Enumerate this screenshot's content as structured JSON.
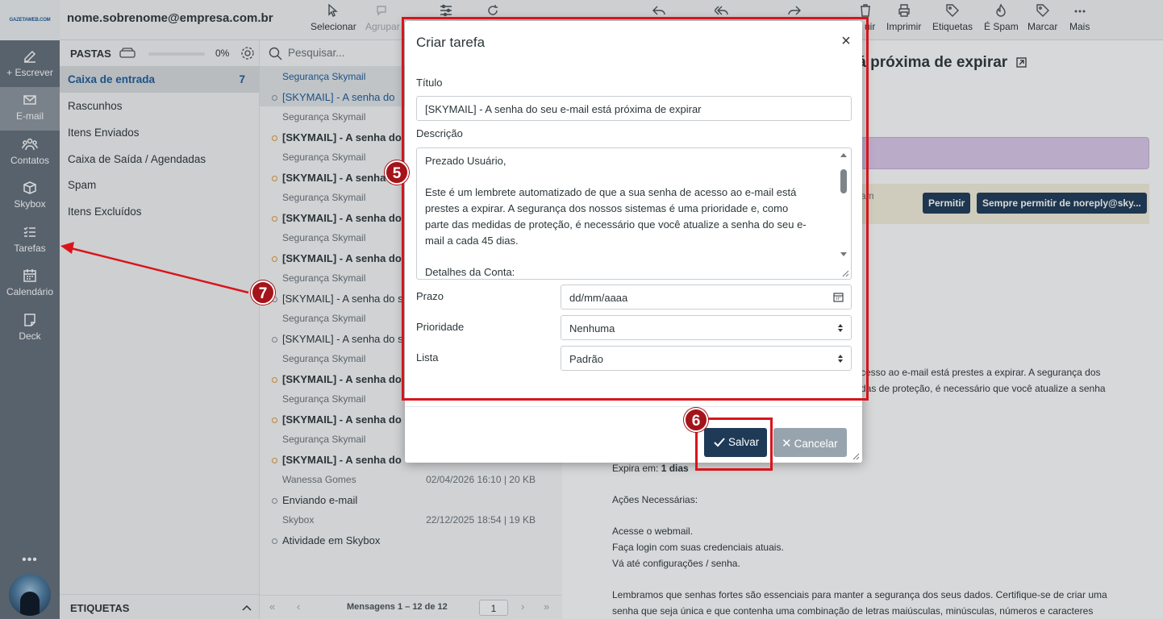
{
  "logo_text": "GAZETAWEB.COM",
  "user_email": "nome.sobrenome@empresa.com.br",
  "nav": {
    "compose": "+ Escrever",
    "email": "E-mail",
    "contacts": "Contatos",
    "skybox": "Skybox",
    "tasks": "Tarefas",
    "calendar": "Calendário",
    "deck": "Deck",
    "more": "•••"
  },
  "toolbar": {
    "select": "Selecionar",
    "group": "Agrupar",
    "delete_partial": "uir",
    "print": "Imprimir",
    "tags": "Etiquetas",
    "spam": "É Spam",
    "mark": "Marcar",
    "more": "Mais"
  },
  "folders": {
    "title": "PASTAS",
    "quota": "0%",
    "items": [
      {
        "label": "Caixa de entrada",
        "count": "7"
      },
      {
        "label": "Rascunhos"
      },
      {
        "label": "Itens Enviados"
      },
      {
        "label": "Caixa de Saída / Agendadas"
      },
      {
        "label": "Spam"
      },
      {
        "label": "Itens Excluídos"
      }
    ],
    "tags_title": "ETIQUETAS"
  },
  "search": {
    "placeholder": "Pesquisar..."
  },
  "messages": [
    {
      "from": "Segurança Skymail",
      "subject": "[SKYMAIL] - A senha do"
    },
    {
      "from": "Segurança Skymail",
      "subject": "[SKYMAIL] - A senha do"
    },
    {
      "from": "Segurança Skymail",
      "subject": "[SKYMAIL] - A senha"
    },
    {
      "from": "Segurança Skymail",
      "subject": "[SKYMAIL] - A senha do"
    },
    {
      "from": "Segurança Skymail",
      "subject": "[SKYMAIL] - A senha do"
    },
    {
      "from": "Segurança Skymail",
      "subject": "[SKYMAIL] - A senha do s"
    },
    {
      "from": "Segurança Skymail",
      "subject": "[SKYMAIL] - A senha do s"
    },
    {
      "from": "Segurança Skymail",
      "subject": "[SKYMAIL] - A senha do"
    },
    {
      "from": "Segurança Skymail",
      "subject": "[SKYMAIL] - A senha do"
    },
    {
      "from": "Segurança Skymail",
      "subject": "[SKYMAIL] - A senha do"
    },
    {
      "from": "Wanessa Gomes",
      "meta": "02/04/2026 16:10 | 20 KB",
      "subject": "Enviando e-mail"
    },
    {
      "from": "Skybox",
      "meta": "22/12/2025 18:54 | 19 KB",
      "subject": "Atividade em Skybox"
    }
  ],
  "pager": {
    "label": "Mensagens 1 – 12 de 12",
    "page": "1"
  },
  "preview": {
    "title_fragment": "tá próxima de expirar",
    "warn_fragment": "am",
    "allow": "Permitir",
    "always_allow": "Sempre permitir de noreply@sky...",
    "body_line1": "cesso ao e-mail está prestes a expirar. A segurança dos",
    "body_line2": "das de proteção, é necessário que você atualize a senha",
    "expires_label": "Expira em:",
    "expires_value": "1 dias",
    "actions_title": "Ações Necessárias:",
    "action1": "Acesse o webmail.",
    "action2": "Faça login com suas credenciais atuais.",
    "action3": "Vá até configurações / senha.",
    "closing1": "Lembramos que senhas fortes são essenciais para manter a segurança dos seus dados. Certifique-se de criar uma",
    "closing2": "senha que seja única e que contenha uma combinação de letras maiúsculas, minúsculas, números e caracteres"
  },
  "dialog": {
    "title": "Criar tarefa",
    "title_label": "Título",
    "title_value": "[SKYMAIL] - A senha do seu e-mail está próxima de expirar",
    "desc_label": "Descrição",
    "desc_lines": [
      "Prezado Usuário,",
      "",
      "Este é um lembrete automatizado de que a sua senha de acesso ao e-mail está",
      "prestes a expirar. A segurança dos nossos sistemas é uma prioridade e, como",
      "parte das medidas de proteção, é necessário que você atualize a senha do seu e-",
      "mail a cada 45 dias.",
      "",
      "Detalhes da Conta:"
    ],
    "due_label": "Prazo",
    "due_placeholder": "dd/mm/aaaa",
    "priority_label": "Prioridade",
    "priority_value": "Nenhuma",
    "list_label": "Lista",
    "list_value": "Padrão",
    "save": "Salvar",
    "cancel": "Cancelar"
  },
  "annotations": {
    "step5": "5",
    "step6": "6",
    "step7": "7"
  },
  "colors": {
    "accent": "#1d5c9b",
    "nav_bg": "#65707c",
    "primary_button": "#1e3a57",
    "annotation_red": "#d9141b"
  }
}
